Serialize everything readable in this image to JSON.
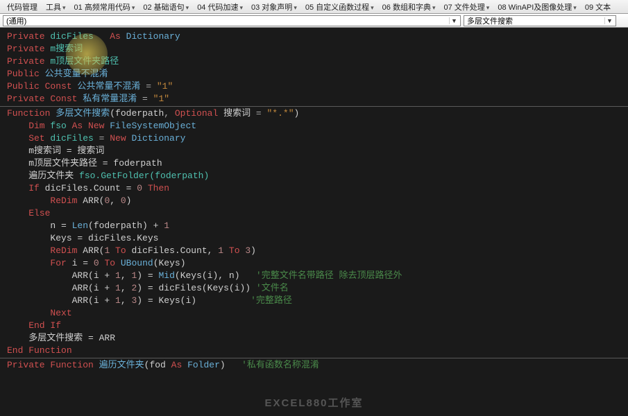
{
  "toolbar": {
    "items": [
      {
        "label": "代码管理"
      },
      {
        "label": "工具"
      },
      {
        "label": "01 高频常用代码"
      },
      {
        "label": "02 基础语句"
      },
      {
        "label": "04 代码加速"
      },
      {
        "label": "03 对象声明"
      },
      {
        "label": "05 自定义函数过程"
      },
      {
        "label": "06 数组和字典"
      },
      {
        "label": "07 文件处理"
      },
      {
        "label": "08 WinAPI及图像处理"
      },
      {
        "label": "09 文本"
      }
    ]
  },
  "dropdowns": {
    "left": "(通用)",
    "right": "多层文件搜索"
  },
  "code": {
    "l1_priv": "Private",
    "l1_id": " dicFiles ",
    "l1_as": "  As",
    "l1_ty": " Dictionary",
    "l2_priv": "Private",
    "l2_id": " m搜索词",
    "l3_priv": "Private",
    "l3_id": " m顶层文件夹路径",
    "l4_pub": "Public",
    "l4_id": " 公共变量不混淆",
    "l5_pub": "Public Const",
    "l5_id": " 公共常量不混淆",
    "l5_eq": " = ",
    "l5_str": "\"1\"",
    "l6_priv": "Private Const",
    "l6_id": " 私有常量混淆",
    "l6_eq": " = ",
    "l6_str": "\"1\"",
    "l7_func": "Function",
    "l7_name": " 多层文件搜索",
    "l7_p1": "(foderpath",
    "l7_comma": ", ",
    "l7_opt": "Optional",
    "l7_p2": " 搜索词 ",
    "l7_eq": "= ",
    "l7_str": "\"*.*\"",
    "l7_close": ")",
    "l8_dim": "    Dim",
    "l8_id": " fso ",
    "l8_as": "As New",
    "l8_ty": " FileSystemObject",
    "l9_set": "    Set",
    "l9_id": " dicFiles ",
    "l9_eq": "= ",
    "l9_new": "New",
    "l9_ty": " Dictionary",
    "l10": "    m搜索词 = 搜索词",
    "l11": "    m顶层文件夹路径 = foderpath",
    "l12_id": "    遍历文件夹 ",
    "l12_call": "fso.GetFolder(foderpath)",
    "l13_if": "    If",
    "l13_cond": " dicFiles.Count = ",
    "l13_zero": "0",
    "l13_then": " Then",
    "l14_redim": "        ReDim",
    "l14_arr": " ARR(",
    "l14_n1": "0",
    "l14_c": ", ",
    "l14_n2": "0",
    "l14_close": ")",
    "l15_else": "    Else",
    "l16": "        n = ",
    "l16_len": "Len",
    "l16_p": "(foderpath) + ",
    "l16_one": "1",
    "l17": "        Keys = dicFiles.Keys",
    "l18_redim": "        ReDim",
    "l18_a": " ARR(",
    "l18_n1": "1",
    "l18_to1": " To ",
    "l18_m": "dicFiles.Count, ",
    "l18_n2": "1",
    "l18_to2": " To ",
    "l18_n3": "3",
    "l18_close": ")",
    "l19_for": "        For",
    "l19_i": " i = ",
    "l19_zero": "0",
    "l19_to": " To ",
    "l19_ub": "UBound",
    "l19_k": "(Keys)",
    "l20_a": "            ARR(i + ",
    "l20_n1": "1",
    "l20_c1": ", ",
    "l20_n2": "1",
    "l20_eq": ") = ",
    "l20_mid": "Mid",
    "l20_p": "(Keys(i), n)   ",
    "l20_cmt": "'完整文件名带路径 除去顶层路径外",
    "l21_a": "            ARR(i + ",
    "l21_n1": "1",
    "l21_c1": ", ",
    "l21_n2": "2",
    "l21_eq": ") = dicFiles(Keys(i)) ",
    "l21_cmt": "'文件名",
    "l22_a": "            ARR(i + ",
    "l22_n1": "1",
    "l22_c1": ", ",
    "l22_n2": "3",
    "l22_eq": ") = Keys(i)          ",
    "l22_cmt": "'完整路径",
    "l23_next": "        Next",
    "l24_endif": "    End If",
    "l25": "    多层文件搜索 = ARR",
    "l26_endfunc": "End Function",
    "l27_priv": "Private Function",
    "l27_name": " 遍历文件夹",
    "l27_p": "(fod ",
    "l27_as": "As",
    "l27_ty": " Folder",
    "l27_close": ")   ",
    "l27_cmt": "'私有函数名称混淆"
  },
  "watermark": "EXCEL880工作室"
}
